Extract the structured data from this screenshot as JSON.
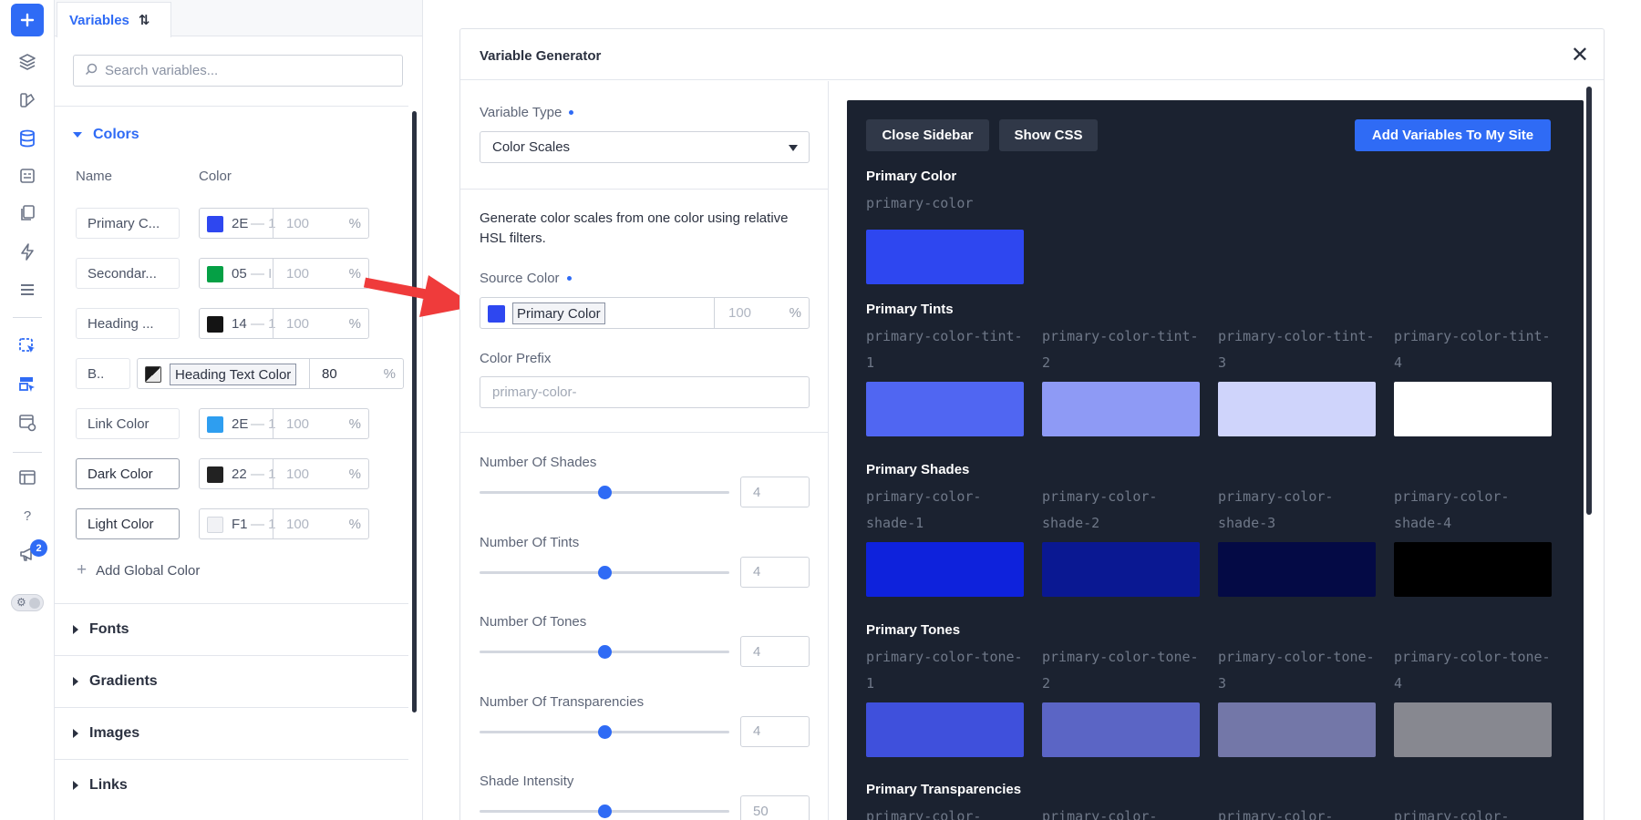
{
  "rail": {
    "badge_count": "2",
    "toggle_glyph": "⚙"
  },
  "variables_panel": {
    "tab_label": "Variables",
    "sort_glyph": "⇅",
    "search_placeholder": "Search variables...",
    "colors_section": {
      "title": "Colors",
      "col_name": "Name",
      "col_color": "Color",
      "rows": [
        {
          "name": "Primary C...",
          "hex": "2E",
          "dash": "— 1",
          "percent": "100",
          "unit": "%",
          "swatch": "#2e47f0"
        },
        {
          "name": "Secondar...",
          "hex": "05",
          "dash": "— I",
          "percent": "100",
          "unit": "%",
          "swatch": "#05a045"
        },
        {
          "name": "Heading ...",
          "hex": "14",
          "dash": "— 1",
          "percent": "100",
          "unit": "%",
          "swatch": "#141414"
        },
        {
          "name": "Link Color",
          "hex": "2E",
          "dash": "— 1",
          "percent": "100",
          "unit": "%",
          "swatch": "#2e9ef0"
        },
        {
          "name": "Dark Color",
          "hex": "22",
          "dash": "— 1",
          "percent": "100",
          "unit": "%",
          "swatch": "#222222"
        },
        {
          "name": "Light Color",
          "hex": "F1",
          "dash": "— 1",
          "percent": "100",
          "unit": "%",
          "swatch": "#f1f2f5"
        }
      ],
      "editing_row": {
        "name": "B..",
        "chip": "Heading Text Color",
        "percent": "80",
        "unit": "%"
      },
      "add_label": "Add Global Color"
    },
    "sections": [
      "Fonts",
      "Gradients",
      "Images",
      "Links"
    ]
  },
  "modal": {
    "title": "Variable Generator",
    "close_glyph": "✕",
    "variable_type_label": "Variable Type",
    "variable_type_value": "Color Scales",
    "description": "Generate color scales from one color using relative HSL filters.",
    "source_color_label": "Source Color",
    "source_color_chip": "Primary Color",
    "source_color_percent": "100",
    "source_color_unit": "%",
    "prefix_label": "Color Prefix",
    "prefix_placeholder": "primary-color-",
    "sliders": [
      {
        "label": "Number Of Shades",
        "value": "4",
        "position": 0.5
      },
      {
        "label": "Number Of Tints",
        "value": "4",
        "position": 0.5
      },
      {
        "label": "Number Of Tones",
        "value": "4",
        "position": 0.5
      },
      {
        "label": "Number Of Transparencies",
        "value": "4",
        "position": 0.5
      },
      {
        "label": "Shade Intensity",
        "value": "50",
        "position": 0.5
      }
    ]
  },
  "preview": {
    "close_sidebar": "Close Sidebar",
    "show_css": "Show CSS",
    "add_variables": "Add Variables To My Site",
    "primary": {
      "title": "Primary Color",
      "var": "primary-color",
      "color": "#2e47f0"
    },
    "groups": [
      {
        "title": "Primary Tints",
        "items": [
          {
            "var1": "primary-color-tint-",
            "var2": "1",
            "color": "#5066f2"
          },
          {
            "var1": "primary-color-tint-",
            "var2": "2",
            "color": "#8e9af5"
          },
          {
            "var1": "primary-color-tint-",
            "var2": "3",
            "color": "#cfd4fb"
          },
          {
            "var1": "primary-color-tint-",
            "var2": "4",
            "color": "#ffffff"
          }
        ]
      },
      {
        "title": "Primary Shades",
        "items": [
          {
            "var1": "primary-color-",
            "var2": "shade-1",
            "color": "#0e22dc"
          },
          {
            "var1": "primary-color-",
            "var2": "shade-2",
            "color": "#0a1892"
          },
          {
            "var1": "primary-color-",
            "var2": "shade-3",
            "color": "#040a45"
          },
          {
            "var1": "primary-color-",
            "var2": "shade-4",
            "color": "#000000"
          }
        ]
      },
      {
        "title": "Primary Tones",
        "items": [
          {
            "var1": "primary-color-tone-",
            "var2": "1",
            "color": "#3f50dc"
          },
          {
            "var1": "primary-color-tone-",
            "var2": "2",
            "color": "#5b65c5"
          },
          {
            "var1": "primary-color-tone-",
            "var2": "3",
            "color": "#7377a8"
          },
          {
            "var1": "primary-color-tone-",
            "var2": "4",
            "color": "#878890"
          }
        ]
      }
    ],
    "transparencies_title": "Primary Transparencies",
    "transparency_var": "primary-color-"
  }
}
